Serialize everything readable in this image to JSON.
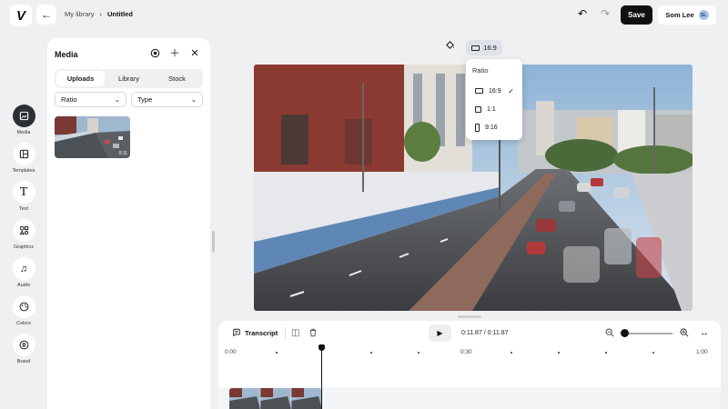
{
  "header": {
    "logo": "V",
    "breadcrumb_parent": "My library",
    "breadcrumb_current": "Untitled",
    "save_label": "Save",
    "user_name": "Som Lee",
    "user_initials": "SL"
  },
  "rail": {
    "items": [
      {
        "label": "Media",
        "icon": "media-icon",
        "active": true
      },
      {
        "label": "Templates",
        "icon": "templates-icon"
      },
      {
        "label": "Text",
        "icon": "text-icon"
      },
      {
        "label": "Graphics",
        "icon": "graphics-icon"
      },
      {
        "label": "Audio",
        "icon": "audio-icon"
      },
      {
        "label": "Colors",
        "icon": "colors-icon"
      },
      {
        "label": "Brand",
        "icon": "brand-icon"
      }
    ]
  },
  "media": {
    "title": "Media",
    "tabs": [
      "Uploads",
      "Library",
      "Stock"
    ],
    "active_tab": "Uploads",
    "filter_ratio": "Ratio",
    "filter_type": "Type",
    "thumb_duration": "0:11"
  },
  "ratio": {
    "current": "16:9",
    "menu_title": "Ratio",
    "options": [
      "16:9",
      "1:1",
      "9:16"
    ],
    "selected": "16:9"
  },
  "timeline": {
    "transcript_label": "Transcript",
    "time_display": "0:11.87 / 0:11.87",
    "ticks": [
      "0:00",
      "0:30",
      "1:00"
    ]
  }
}
